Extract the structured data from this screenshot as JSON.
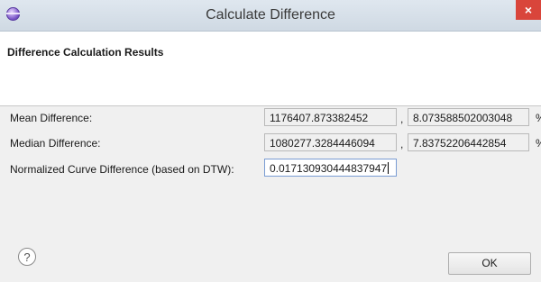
{
  "window": {
    "title": "Calculate Difference",
    "close_label": "×"
  },
  "header": {
    "title": "Difference Calculation Results"
  },
  "rows": [
    {
      "label": "Mean Difference:",
      "value": "1176407.873382452",
      "comma": ",",
      "percent_value": "8.073588502003048",
      "percent_sign": "%"
    },
    {
      "label": "Median Difference:",
      "value": "1080277.3284446094",
      "comma": ",",
      "percent_value": "7.83752206442854",
      "percent_sign": "%"
    },
    {
      "label": "Normalized Curve Difference (based on DTW):",
      "value": "0.017130930444837947"
    }
  ],
  "help": {
    "glyph": "?"
  },
  "buttons": {
    "ok_label": "OK"
  },
  "colors": {
    "titlebar": "#d6dfe8",
    "close": "#d9453b",
    "dialog_bg": "#f0f0f0"
  },
  "icons": {
    "app": "eclipse-icon",
    "help": "help-icon",
    "close": "close-icon"
  }
}
